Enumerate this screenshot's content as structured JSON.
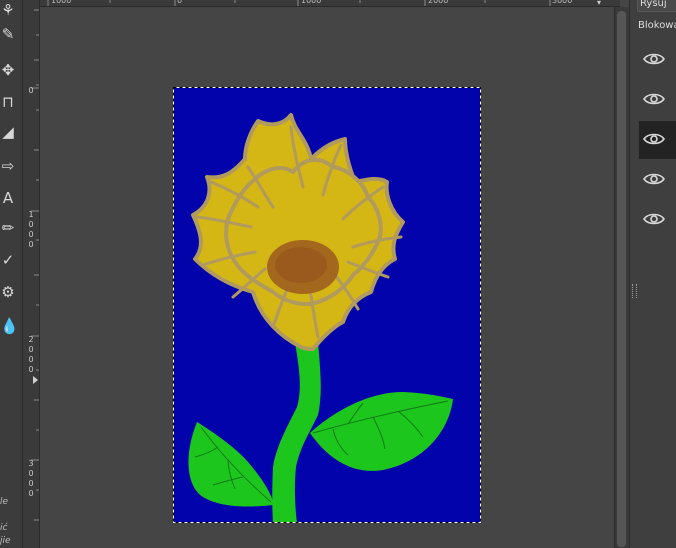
{
  "toolbox": {
    "tools": [
      {
        "name": "fuzzy-select-icon",
        "glyph": "⚘"
      },
      {
        "name": "color-picker-icon",
        "glyph": "✎"
      },
      {
        "name": "move-tool-icon",
        "glyph": "✥"
      },
      {
        "name": "crop-tool-icon",
        "glyph": "⊓"
      },
      {
        "name": "shear-tool-icon",
        "glyph": "◢"
      },
      {
        "name": "flip-tool-icon",
        "glyph": "⇨"
      },
      {
        "name": "text-tool-icon",
        "glyph": "A"
      },
      {
        "name": "paintbrush-icon",
        "glyph": "✏"
      },
      {
        "name": "heal-tool-icon",
        "glyph": "✓"
      },
      {
        "name": "clone-tool-icon",
        "glyph": "⚙"
      },
      {
        "name": "smudge-tool-icon",
        "glyph": "💧"
      }
    ],
    "labels": [
      "le",
      "ić",
      "jie"
    ]
  },
  "rulers": {
    "horizontal_ticks": [
      "1000",
      "0",
      "1000",
      "2000",
      "3000"
    ],
    "vertical_ticks": [
      "0",
      "1000",
      "2000",
      "3000"
    ]
  },
  "layers_panel": {
    "mode_field": "Rysuj",
    "lock_label": "Blokowa",
    "layers": [
      {
        "visible": true,
        "selected": false
      },
      {
        "visible": true,
        "selected": false
      },
      {
        "visible": true,
        "selected": true
      },
      {
        "visible": true,
        "selected": false
      },
      {
        "visible": true,
        "selected": false
      }
    ]
  },
  "colors": {
    "sky": "#0303ab",
    "petals": "#d4b614",
    "petal_outline": "#b09a5e",
    "center": "#9a5a1e",
    "stem": "#1cc61c",
    "leaf_vein": "#0f7a18"
  }
}
